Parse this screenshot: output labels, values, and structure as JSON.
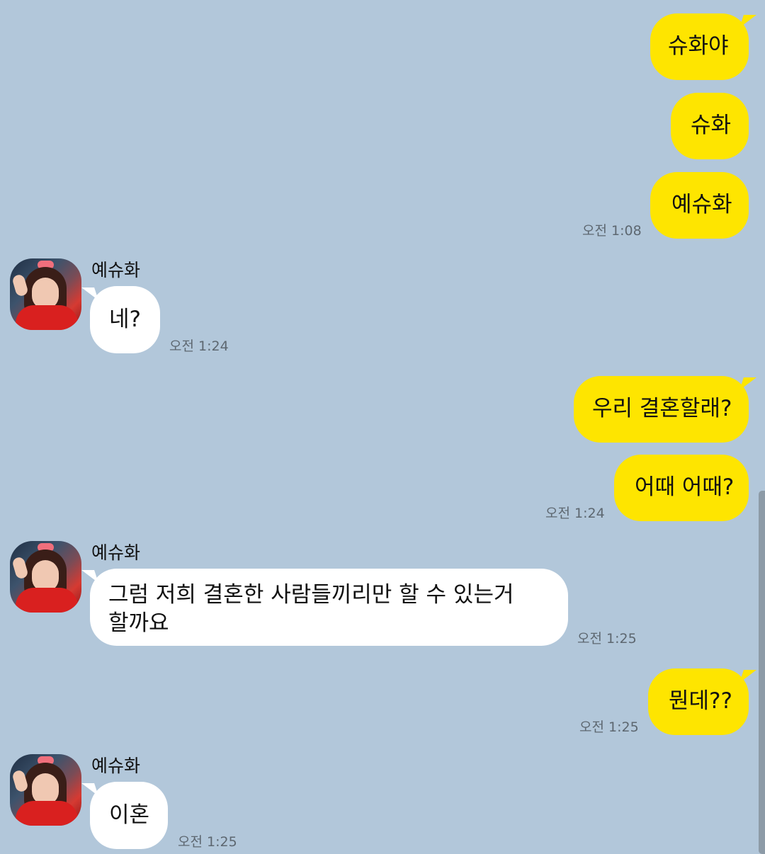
{
  "colors": {
    "background": "#b2c7da",
    "outgoing_bubble": "#fee500",
    "incoming_bubble": "#ffffff",
    "time_text": "#5d6770"
  },
  "messages": [
    {
      "side": "outgoing",
      "text": "슈화야"
    },
    {
      "side": "outgoing",
      "text": "슈화"
    },
    {
      "side": "outgoing",
      "text": "예슈화",
      "time": "오전 1:08"
    },
    {
      "side": "incoming",
      "sender": "예슈화",
      "text": "네?",
      "time": "오전 1:24",
      "avatar_icon": "profile-photo"
    },
    {
      "side": "outgoing",
      "text": "우리 결혼할래?"
    },
    {
      "side": "outgoing",
      "text": "어때 어때?",
      "time": "오전 1:24"
    },
    {
      "side": "incoming",
      "sender": "예슈화",
      "text_line1": "그럼 저희 결혼한 사람들끼리만 할 수 있는거",
      "text_line2": "할까요",
      "time": "오전 1:25",
      "avatar_icon": "profile-photo"
    },
    {
      "side": "outgoing",
      "text": "뭔데??",
      "time": "오전 1:25"
    },
    {
      "side": "incoming",
      "sender": "예슈화",
      "text": "이혼",
      "time": "오전 1:25",
      "avatar_icon": "profile-photo"
    }
  ]
}
